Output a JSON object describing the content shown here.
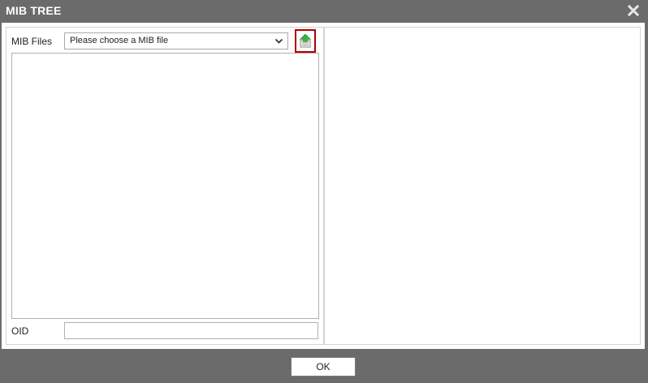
{
  "window": {
    "title": "MIB TREE",
    "close_icon": "close-icon"
  },
  "mib_files": {
    "label": "MIB Files",
    "selected": "Please choose a MIB file",
    "upload_icon": "upload-file-icon"
  },
  "oid": {
    "label": "OID",
    "value": ""
  },
  "footer": {
    "ok_label": "OK"
  },
  "colors": {
    "titlebar": "#6b6b6b",
    "annotation": "#b00000",
    "upload_arrow": "#3cb043"
  }
}
